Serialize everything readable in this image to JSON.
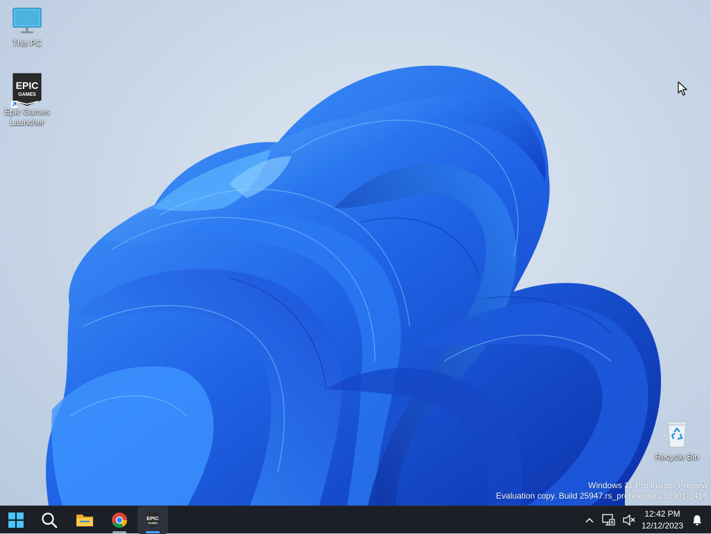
{
  "desktop": {
    "icons": [
      {
        "label": "This PC",
        "icon": "monitor-icon"
      },
      {
        "label": "Epic Games Launcher",
        "label_line1": "Epic Games",
        "label_line2": "Launcher",
        "icon": "epic-games-icon",
        "logo_text_top": "EPIC",
        "logo_text_bottom": "GAMES"
      },
      {
        "label": "Recycle Bin",
        "icon": "recycle-bin-icon"
      }
    ],
    "watermark": {
      "line1": "Windows 11 Pro Insider Preview",
      "line2": "Evaluation copy. Build 25947.rs_prerelease.230901-1416"
    }
  },
  "taskbar": {
    "apps": [
      {
        "name": "Start",
        "icon": "windows-start-icon"
      },
      {
        "name": "Search",
        "icon": "search-icon"
      },
      {
        "name": "File Explorer",
        "icon": "folder-icon"
      },
      {
        "name": "Google Chrome",
        "icon": "chrome-icon",
        "running": true
      },
      {
        "name": "Epic Games Launcher",
        "icon": "epic-games-icon",
        "running": true,
        "active": true,
        "logo_text": "EPIC",
        "logo_sub": "GAMES"
      }
    ],
    "tray": {
      "chevron": "chevron-up-icon",
      "network": "network-disconnected-icon",
      "volume": "volume-muted-icon",
      "time": "12:42 PM",
      "date": "12/12/2023",
      "notifications": "bell-icon"
    }
  },
  "colors": {
    "wallpaper_bg": "#c9d7e8",
    "bloom_blue": "#1e5fe0",
    "taskbar_bg": "#1c1f26",
    "accent": "#4ea3ff"
  }
}
